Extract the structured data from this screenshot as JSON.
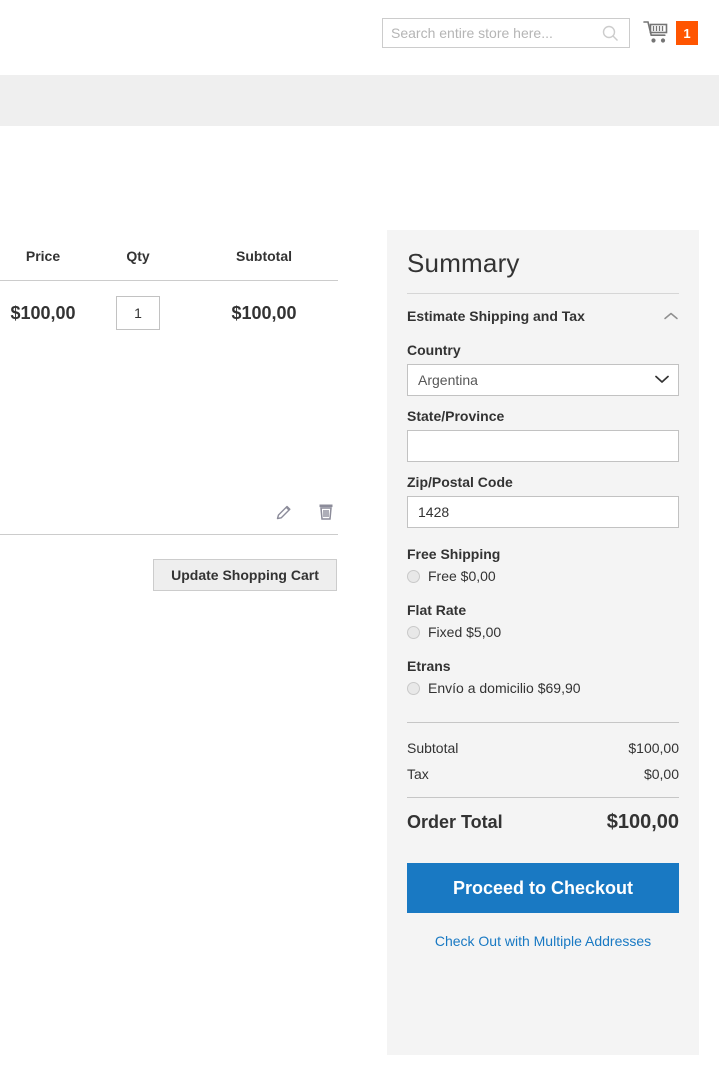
{
  "header": {
    "search": {
      "placeholder": "Search entire store here...",
      "value": "",
      "icon": "search-icon"
    },
    "cart": {
      "icon": "shopping-cart-icon",
      "count": "1",
      "badge_color": "#ff5501"
    }
  },
  "cart_table": {
    "columns": [
      "Price",
      "Qty",
      "Subtotal"
    ],
    "rows": [
      {
        "price": "$100,00",
        "qty": "1",
        "subtotal": "$100,00"
      }
    ],
    "row_actions": {
      "edit_icon": "pencil-icon",
      "remove_icon": "trash-icon"
    },
    "update_button": "Update Shopping Cart"
  },
  "summary": {
    "title": "Summary",
    "estimate_section": {
      "label": "Estimate Shipping and Tax",
      "toggle_icon": "chevron-up-icon"
    },
    "country": {
      "label": "Country",
      "value": "Argentina",
      "options": [
        "Argentina"
      ]
    },
    "state": {
      "label": "State/Province",
      "value": "",
      "placeholder": ""
    },
    "zip": {
      "label": "Zip/Postal Code",
      "value": "1428",
      "placeholder": ""
    },
    "shipping_methods": [
      {
        "group": "Free Shipping",
        "option": "Free $0,00",
        "selected": false
      },
      {
        "group": "Flat Rate",
        "option": "Fixed $5,00",
        "selected": false
      },
      {
        "group": "Etrans",
        "option": "Envío a domicilio $69,90",
        "selected": false
      }
    ],
    "totals": [
      {
        "label": "Subtotal",
        "value": "$100,00"
      },
      {
        "label": "Tax",
        "value": "$0,00"
      }
    ],
    "order_total": {
      "label": "Order Total",
      "value": "$100,00"
    },
    "checkout_button": {
      "label": "Proceed to Checkout",
      "color": "#1979c3"
    },
    "multi_address_link": {
      "label": "Check Out with Multiple Addresses",
      "color": "#1979c3"
    }
  }
}
